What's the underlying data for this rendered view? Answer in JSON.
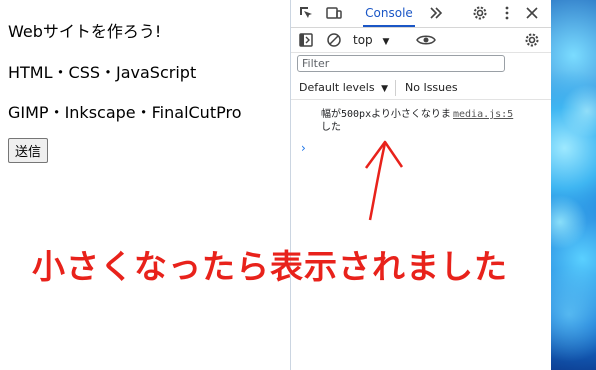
{
  "webpage": {
    "line1": "Webサイトを作ろう!",
    "line2": "HTML・CSS・JavaScript",
    "line3": "GIMP・Inkscape・FinalCutPro",
    "submit_label": "送信"
  },
  "devtools": {
    "tabs": {
      "console": "Console"
    },
    "toolbar": {
      "context": "top"
    },
    "filter": {
      "placeholder": "Filter"
    },
    "levels": {
      "label": "Default levels",
      "issues": "No Issues"
    },
    "log": {
      "message_line1": "幅が500pxより小さくなりま",
      "message_line2": "した",
      "source": "media.js:5"
    },
    "prompt": "›"
  },
  "annotation": {
    "text": "小さくなったら表示されました",
    "color": "#e8221b"
  },
  "colors": {
    "devtools_accent": "#1a56c6",
    "wallpaper": "#0f63c9"
  }
}
